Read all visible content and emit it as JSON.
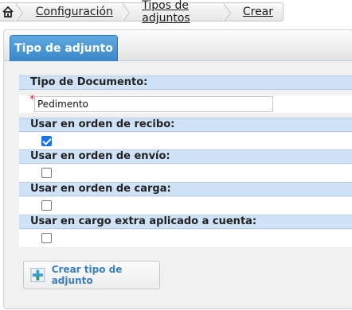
{
  "breadcrumb": {
    "items": [
      "Configuración",
      "Tipos de adjuntos",
      "Crear"
    ]
  },
  "tab": {
    "label": "Tipo de adjunto"
  },
  "form": {
    "tipo_documento": {
      "label": "Tipo de Documento:",
      "value": "Pedimento",
      "required_mark": "*"
    },
    "orden_recibo": {
      "label": "Usar en orden de recibo:",
      "checked": true
    },
    "orden_envio": {
      "label": "Usar en orden de envío:",
      "checked": false
    },
    "orden_carga": {
      "label": "Usar en orden de carga:",
      "checked": false
    },
    "cargo_extra": {
      "label": "Usar en cargo extra aplicado a cuenta:",
      "checked": false
    }
  },
  "actions": {
    "create_label": "Crear tipo de adjunto"
  },
  "colors": {
    "accent": "#3a86c8",
    "row_header": "#cfe2f8",
    "checkbox_checked": "#1a73e8",
    "required": "#d02020"
  }
}
